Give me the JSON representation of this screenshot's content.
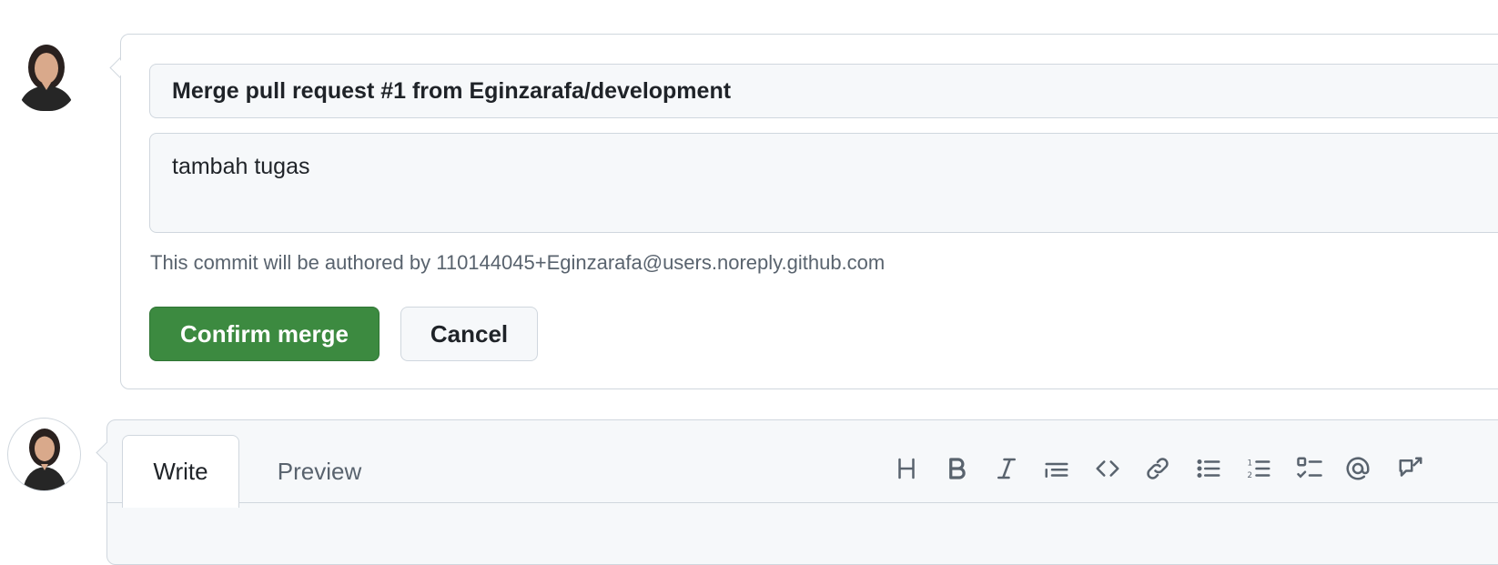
{
  "merge_form": {
    "commit_title": "Merge pull request #1 from Eginzarafa/development",
    "commit_message": "tambah tugas",
    "author_note": "This commit will be authored by 110144045+Eginzarafa@users.noreply.github.com",
    "confirm_label": "Confirm merge",
    "cancel_label": "Cancel",
    "confirm_color": "#3c8a40"
  },
  "comment_editor": {
    "tabs": [
      "Write",
      "Preview"
    ],
    "active_tab": "Write",
    "toolbar_icons": [
      "heading-icon",
      "bold-icon",
      "italic-icon",
      "quote-icon",
      "code-icon",
      "link-icon",
      "unordered-list-icon",
      "ordered-list-icon",
      "task-list-icon",
      "mention-icon",
      "reference-icon"
    ]
  },
  "colors": {
    "border": "#d0d7de",
    "muted_text": "#59636e",
    "input_bg": "#f6f8fa"
  }
}
